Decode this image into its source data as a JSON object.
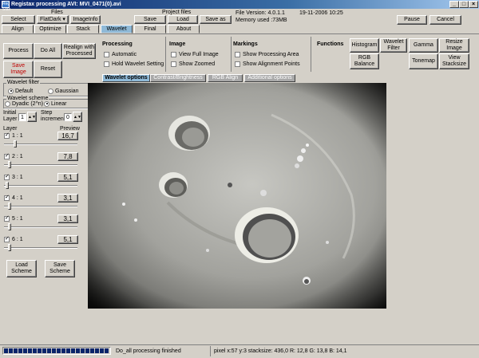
{
  "window": {
    "title": "Registax processing AVI: MVI_0471(0).avi",
    "icon_text": "Reg Stax"
  },
  "toolbar": {
    "files_label": "Files",
    "select_label": "Select",
    "flatdark_label": "FlatDark ▾",
    "imageinfo_label": "ImageInfo",
    "project_files_label": "Project files",
    "save_label": "Save",
    "load_label": "Load",
    "save_as_label": "Save as",
    "file_version": "File Version: 4.0.1.1",
    "datetime": "19-11-2006 10:25",
    "memory_used": "Memory used :73MB",
    "pause_label": "Pause",
    "cancel_label": "Cancel"
  },
  "tabs": [
    {
      "label": "Align"
    },
    {
      "label": "Optimize"
    },
    {
      "label": "Stack"
    },
    {
      "label": "Wavelet"
    },
    {
      "label": "Final"
    },
    {
      "label": "About"
    }
  ],
  "actions": {
    "process_label": "Process",
    "doall_label": "Do All",
    "realign_label": "Realign with Processed",
    "save_image_label": "Save Image",
    "reset_label": "Reset"
  },
  "processing": {
    "title": "Processing",
    "automatic": "Automatic",
    "hold_wavelet": "Hold Wavelet Setting"
  },
  "image_opts": {
    "title": "Image",
    "view_full": "View Full Image",
    "show_zoomed": "Show Zoomed"
  },
  "markings": {
    "title": "Markings",
    "show_processing_area": "Show Processing Area",
    "show_alignment_points": "Show Alignment Points"
  },
  "functions": {
    "title": "Functions",
    "histogram": "Histogram",
    "wavelet_filter": "Wavelet Filter",
    "gamma": "Gamma",
    "resize_image": "Resize Image",
    "rgb_balance": "RGB Balance",
    "tonemap": "Tonemap",
    "view_stacksize": "View Stacksize"
  },
  "subtabs": [
    {
      "label": "Wavelet options"
    },
    {
      "label": "Contrast/Brightness"
    },
    {
      "label": "RGB Align"
    },
    {
      "label": "Additional options"
    }
  ],
  "wavelet_panel": {
    "filter_label": "Wavelet filter",
    "default_label": "Default",
    "gaussian_label": "Gaussian",
    "scheme_label": "Wavelet scheme",
    "dyadic_label": "Dyadic (2^n)",
    "linear_label": "Linear",
    "initial_layer_label": "Initial Layer",
    "initial_layer_value": "1",
    "step_increment_label": "Step increment",
    "step_increment_value": "0",
    "layer_header": "Layer",
    "preview_header": "Preview",
    "layers": [
      {
        "name": "1 : 1",
        "preview": "16,7",
        "level": 0.14
      },
      {
        "name": "2 : 1",
        "preview": "7,8",
        "level": 0.06
      },
      {
        "name": "3 : 1",
        "preview": "5,1",
        "level": 0.02
      },
      {
        "name": "4 : 1",
        "preview": "3,1",
        "level": 0.06
      },
      {
        "name": "5 : 1",
        "preview": "3,1",
        "level": 0.06
      },
      {
        "name": "6 : 1",
        "preview": "5,1",
        "level": 0.06
      }
    ],
    "load_scheme_label": "Load Scheme",
    "save_scheme_label": "Save Scheme"
  },
  "status": {
    "progress": 1.0,
    "message": "Do_all processing finished",
    "pixel_info": "pixel x:57 y:3 stacksize: 436,0 R: 12,8 G: 13,8 B: 14,1"
  }
}
